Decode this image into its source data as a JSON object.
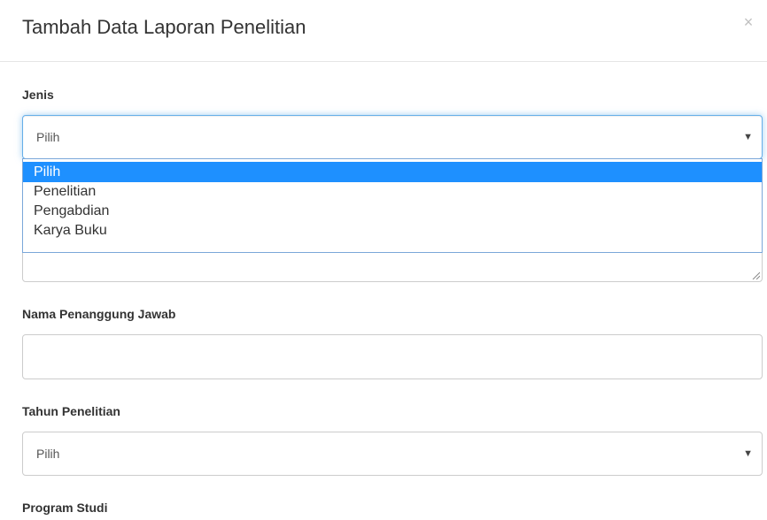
{
  "modal": {
    "title": "Tambah Data Laporan Penelitian",
    "close_symbol": "×"
  },
  "jenis": {
    "label": "Jenis",
    "selected": "Pilih",
    "options": [
      "Pilih",
      "Penelitian",
      "Pengabdian",
      "Karya Buku"
    ],
    "caret": "▼"
  },
  "nama_penanggung_jawab": {
    "label": "Nama Penanggung Jawab",
    "value": ""
  },
  "tahun_penelitian": {
    "label": "Tahun Penelitian",
    "selected": "Pilih",
    "caret": "▼"
  },
  "program_studi": {
    "label": "Program Studi"
  },
  "colors": {
    "accent": "#66afe9",
    "option_highlight": "#1e90ff"
  },
  "icons": [
    "close-icon",
    "caret-down-icon",
    "resize-grip-icon"
  ]
}
